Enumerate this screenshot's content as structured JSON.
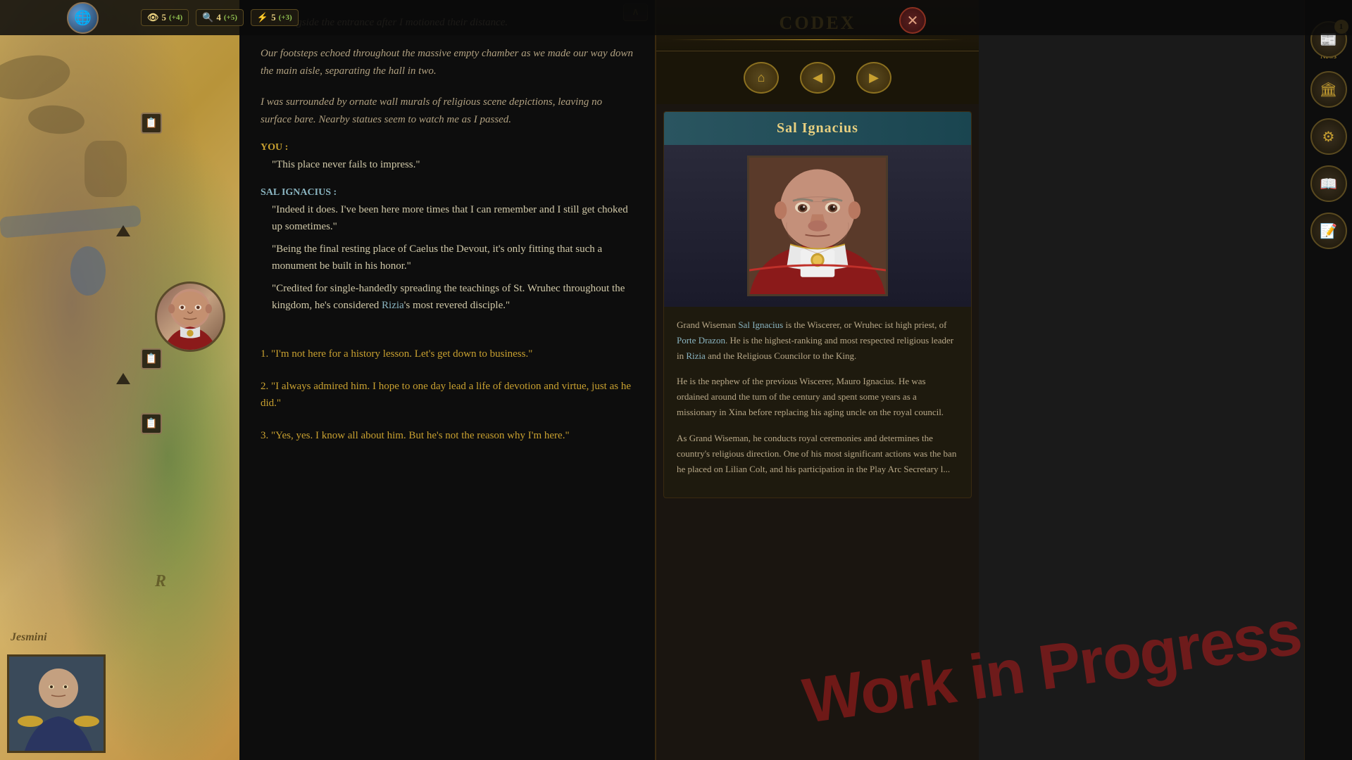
{
  "topbar": {
    "stat1_icon": "👁",
    "stat1_value": "5",
    "stat1_bonus": "(+4)",
    "stat2_icon": "👁",
    "stat2_value": "4",
    "stat2_bonus": "(+5)",
    "stat3_icon": "⚡",
    "stat3_value": "5",
    "stat3_bonus": "(+3)"
  },
  "dialogue": {
    "narration1": "ace alongside the entrance after I motioned their distance.",
    "narration2": "Our footsteps echoed throughout the massive empty chamber as we made our way down the main aisle, separating the hall in two.",
    "narration3": "I was surrounded by ornate wall murals of religious scene depictions, leaving no surface bare. Nearby statues seem to watch me as I passed.",
    "speaker_you": "YOU",
    "you_colon": ":",
    "you_line": "\"This place never fails to impress.\"",
    "speaker_sal": "SAL IGNACIUS",
    "sal_colon": ":",
    "sal_line1": "\"Indeed it does. I've been here more times that I can remember and I still get choked up sometimes.\"",
    "sal_line2": "\"Being the final resting place of Caelus the Devout, it's only fitting that such a monument be built in his honor.\"",
    "sal_line3": "\"Credited for single-handedly spreading the teachings of St. Wruhec throughout the kingdom, he's considered",
    "sal_link": "Rizia",
    "sal_line3_end": "'s most revered disciple.\"",
    "choice1": "1. \"I'm not here for a history lesson. Let's get down to business.\"",
    "choice2": "2. \"I always admired him. I hope to one day lead a life of devotion and virtue, just as he did.\"",
    "choice3": "3. \"Yes, yes. I know all about him. But he's not the reason why I'm here.\""
  },
  "codex": {
    "title": "Codex",
    "character_name": "Sal Ignacius",
    "body_intro": "Grand Wiseman",
    "body_link1": "Sal Ignacius",
    "body_text1": "is the Wiscerer, or Wruhec ist high priest, of",
    "body_link2": "Porte Drazon",
    "body_text1b": ". He is the highest-ranking and most respected religious leader in",
    "body_link3": "Rizia",
    "body_text1c": "and the Religious Councilor to the King.",
    "body_para2": "He is the nephew of the previous Wiscerer, Mauro Ignacius. He was ordained around the turn of the century and spent some years as a missionary in Xina before replacing his aging uncle on the royal council.",
    "body_para3": "As Grand Wiseman, he conducts royal ceremonies and determines the country's religious direction. One of his most significant actions was the ban he placed on Lilian Colt, and his participation in the Play Arc Secretary l..."
  },
  "sidebar": {
    "news_badge": "1",
    "news_label": "News"
  },
  "map": {
    "label": "Jesmini",
    "letter_r": "R"
  },
  "watermark": "Work in Progress"
}
